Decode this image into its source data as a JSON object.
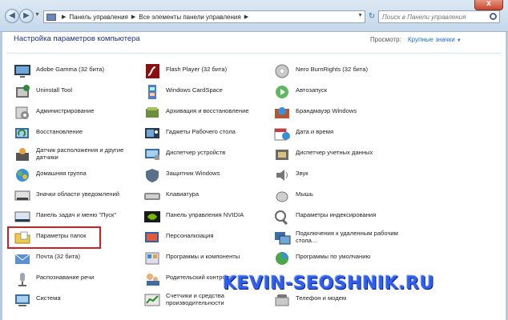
{
  "window": {
    "close_label": "x",
    "back_glyph": "◀",
    "forward_glyph": "▶",
    "refresh_glyph": "↻"
  },
  "breadcrumb": {
    "sep": "▶",
    "items": [
      "Панель управления",
      "Все элементы панели управления"
    ]
  },
  "search": {
    "placeholder": "Поиск в Панели управления"
  },
  "header": {
    "title": "Настройка параметров компьютера",
    "view_label": "Просмотр:",
    "view_value": "Крупные значки"
  },
  "items": {
    "col1": [
      {
        "label": "Adobe Gamma (32 бита)",
        "icon": "monitor-icon"
      },
      {
        "label": "Uninstall Tool",
        "icon": "uninstall-icon"
      },
      {
        "label": "Администрирование",
        "icon": "admin-tools-icon"
      },
      {
        "label": "Восстановление",
        "icon": "recovery-icon"
      },
      {
        "label": "Датчик расположения и другие датчики",
        "icon": "sensor-icon"
      },
      {
        "label": "Домашняя группа",
        "icon": "homegroup-icon"
      },
      {
        "label": "Значки области уведомлений",
        "icon": "notification-icons-icon"
      },
      {
        "label": "Панель задач и меню \"Пуск\"",
        "icon": "taskbar-icon"
      },
      {
        "label": "Параметры папок",
        "icon": "folder-options-icon"
      },
      {
        "label": "Почта (32 бита)",
        "icon": "mail-icon"
      },
      {
        "label": "Распознавание речи",
        "icon": "microphone-icon"
      },
      {
        "label": "Система",
        "icon": "system-icon"
      }
    ],
    "col2": [
      {
        "label": "Flash Player (32 бита)",
        "icon": "flash-icon"
      },
      {
        "label": "Windows CardSpace",
        "icon": "cardspace-icon"
      },
      {
        "label": "Архивация и восстановление",
        "icon": "backup-icon"
      },
      {
        "label": "Гаджеты Рабочего стола",
        "icon": "gadgets-icon"
      },
      {
        "label": "Диспетчер устройств",
        "icon": "device-manager-icon"
      },
      {
        "label": "Защитник Windows",
        "icon": "defender-icon"
      },
      {
        "label": "Клавиатура",
        "icon": "keyboard-icon"
      },
      {
        "label": "Панель управления NVIDIA",
        "icon": "nvidia-icon"
      },
      {
        "label": "Персонализация",
        "icon": "personalization-icon"
      },
      {
        "label": "Программы и компоненты",
        "icon": "programs-icon"
      },
      {
        "label": "Родительский контроль",
        "icon": "parental-control-icon"
      },
      {
        "label": "Счетчики и средства производительности",
        "icon": "performance-icon"
      }
    ],
    "col3": [
      {
        "label": "Nero BurnRights (32 бита)",
        "icon": "nero-icon"
      },
      {
        "label": "Автозапуск",
        "icon": "autoplay-icon"
      },
      {
        "label": "Брандмауэр Windows",
        "icon": "firewall-icon"
      },
      {
        "label": "Дата и время",
        "icon": "datetime-icon"
      },
      {
        "label": "Диспетчер учетных данных",
        "icon": "credential-icon"
      },
      {
        "label": "Звук",
        "icon": "sound-icon"
      },
      {
        "label": "Мышь",
        "icon": "mouse-icon"
      },
      {
        "label": "Параметры индексирования",
        "icon": "indexing-icon"
      },
      {
        "label": "Подключения к удаленным рабочим стола...",
        "icon": "remote-desktop-icon"
      },
      {
        "label": "Программы по умолчанию",
        "icon": "default-programs-icon"
      },
      {
        "label": "",
        "icon": "hidden-icon"
      },
      {
        "label": "Телефон и модем",
        "icon": "phone-modem-icon"
      }
    ]
  },
  "watermark": "KEVIN-SEOSHNIK.RU",
  "colors": {
    "accent": "#1e6ed6",
    "title": "#1e3287",
    "highlight": "#d21e1e",
    "watermark": "#2f5ff0"
  }
}
